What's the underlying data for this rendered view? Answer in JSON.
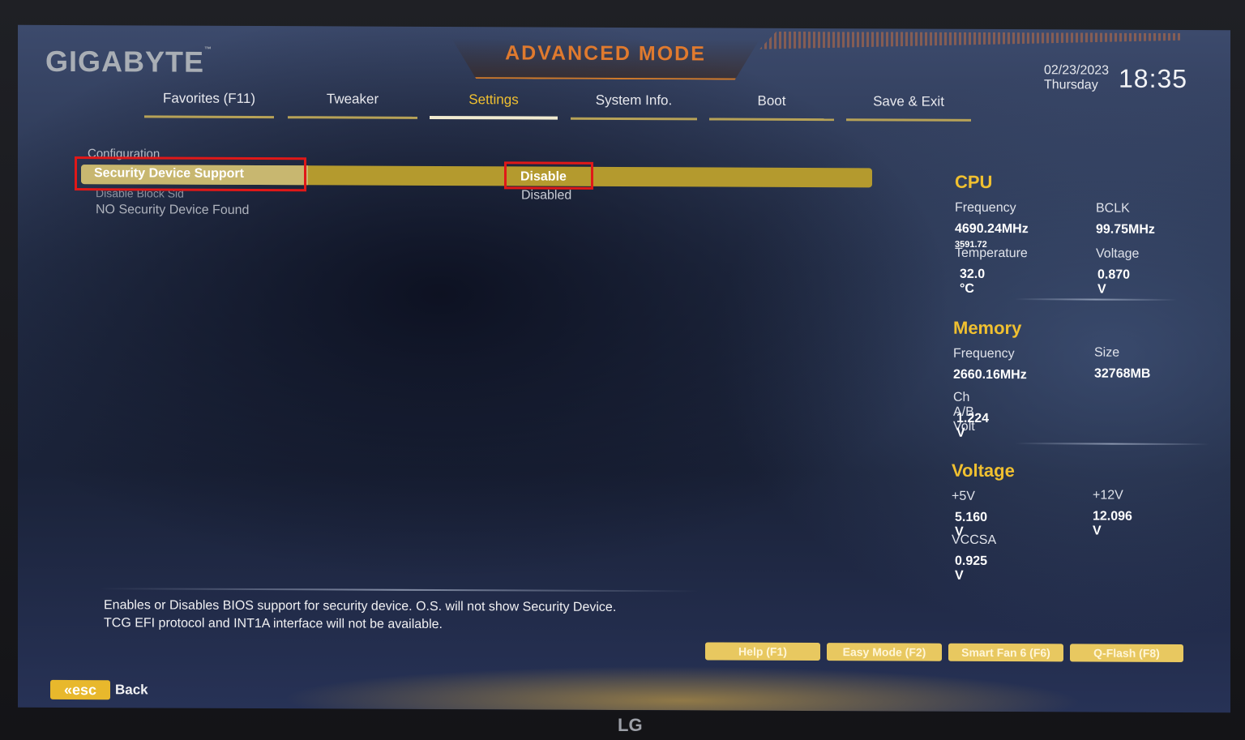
{
  "brand": "GIGABYTE",
  "mode_title": "ADVANCED MODE",
  "date": "02/23/2023",
  "weekday": "Thursday",
  "time": "18:35",
  "tabs": [
    {
      "label": "Favorites (F11)",
      "active": false
    },
    {
      "label": "Tweaker",
      "active": false
    },
    {
      "label": "Settings",
      "active": true
    },
    {
      "label": "System Info.",
      "active": false
    },
    {
      "label": "Boot",
      "active": false
    },
    {
      "label": "Save & Exit",
      "active": false
    }
  ],
  "config": {
    "header": "Configuration",
    "items": [
      {
        "label": "Security Device Support",
        "value": "Disable",
        "selected": true
      },
      {
        "label": "Disable Block Sid",
        "value": "Disabled"
      },
      {
        "label": "NO Security Device Found",
        "value": ""
      }
    ]
  },
  "description": {
    "line1": "Enables or Disables BIOS support for security device. O.S. will not show Security Device.",
    "line2": "TCG EFI protocol and INT1A interface will not be available."
  },
  "cpu": {
    "title": "CPU",
    "frequency_label": "Frequency",
    "frequency_value": "4690.24MHz",
    "frequency_sub": "3591.72",
    "bclk_label": "BCLK",
    "bclk_value": "99.75MHz",
    "temperature_label": "Temperature",
    "temperature_value": "32.0 °C",
    "voltage_label": "Voltage",
    "voltage_value": "0.870 V"
  },
  "memory": {
    "title": "Memory",
    "frequency_label": "Frequency",
    "frequency_value": "2660.16MHz",
    "size_label": "Size",
    "size_value": "32768MB",
    "volt_label": "Ch A/B Volt",
    "volt_value": "1.224 V"
  },
  "voltage": {
    "title": "Voltage",
    "v5_label": "+5V",
    "v5_value": "5.160 V",
    "v12_label": "+12V",
    "v12_value": "12.096 V",
    "vccsa_label": "VCCSA",
    "vccsa_value": "0.925 V"
  },
  "function_buttons": [
    {
      "label": "Help (F1)"
    },
    {
      "label": "Easy Mode (F2)"
    },
    {
      "label": "Smart Fan 6 (F6)"
    },
    {
      "label": "Q-Flash (F8)"
    }
  ],
  "esc_label": "esc",
  "back_label": "Back",
  "monitor_brand": "LG",
  "colors": {
    "accent": "#f0c030",
    "highlight": "#b49a2e",
    "annotation_red": "#e01818"
  }
}
